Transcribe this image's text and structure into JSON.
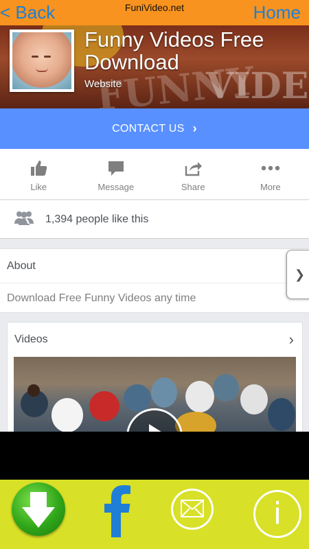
{
  "topbar": {
    "back_label": "< Back",
    "site_name": "FuniVideo.net",
    "home_label": "Home"
  },
  "page": {
    "title": "Funny Videos Free Download",
    "category": "Website",
    "cover_watermark_left": "FUNNY",
    "cover_watermark_right": "VIDEOS"
  },
  "contact": {
    "label": "CONTACT US",
    "chevron": "›"
  },
  "actions": [
    {
      "label": "Like",
      "icon": "thumbs-up-icon"
    },
    {
      "label": "Message",
      "icon": "message-icon"
    },
    {
      "label": "Share",
      "icon": "share-icon"
    },
    {
      "label": "More",
      "icon": "more-dots-icon"
    }
  ],
  "likes": {
    "text": "1,394 people like this",
    "icon": "people-icon"
  },
  "about": {
    "heading": "About",
    "description": "Download Free Funny Videos any time"
  },
  "side_tab": {
    "chevron": "❯"
  },
  "videos": {
    "heading": "Videos",
    "chevron": "›",
    "play_icon": "play-icon"
  },
  "bottom_bar": {
    "background": "#d8e027",
    "buttons": [
      {
        "name": "download",
        "icon": "download-arrow-icon"
      },
      {
        "name": "facebook",
        "icon": "facebook-f-icon",
        "glyph": "f"
      },
      {
        "name": "email",
        "icon": "envelope-icon"
      },
      {
        "name": "info",
        "icon": "info-icon",
        "glyph": "i"
      }
    ]
  },
  "colors": {
    "topbar": "#f7931e",
    "link_blue": "#1f7fd6",
    "contact_blue": "#5890ff",
    "facebook_blue": "#1f7fd6"
  }
}
